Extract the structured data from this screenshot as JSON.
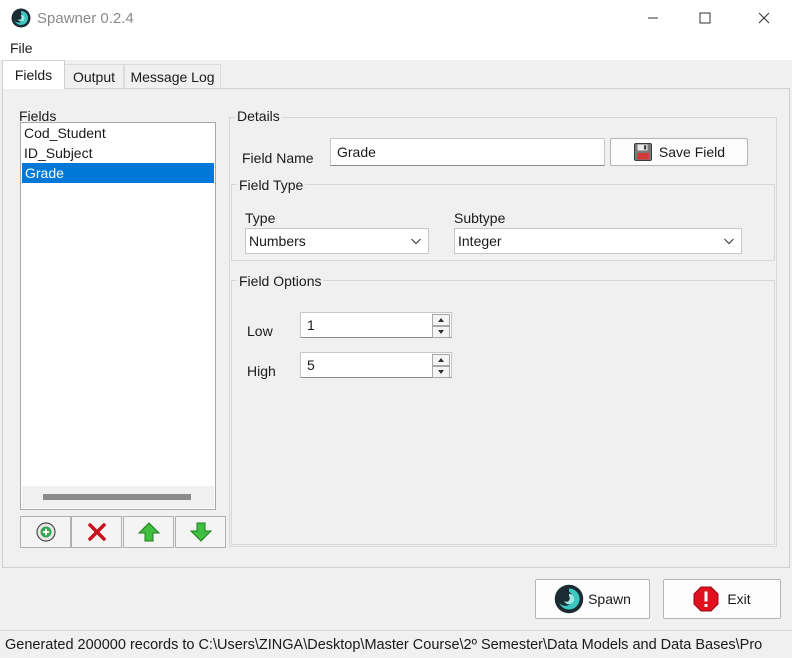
{
  "window": {
    "title": "Spawner 0.2.4",
    "icon": "spawner-swirl-icon"
  },
  "menu": {
    "file": "File"
  },
  "tabs": [
    {
      "label": "Fields",
      "active": true
    },
    {
      "label": "Output",
      "active": false
    },
    {
      "label": "Message Log",
      "active": false
    }
  ],
  "fields_panel": {
    "caption": "Fields",
    "items": [
      {
        "label": "Cod_Student",
        "selected": false
      },
      {
        "label": "ID_Subject",
        "selected": false
      },
      {
        "label": "Grade",
        "selected": true
      }
    ],
    "buttons": [
      {
        "action": "add",
        "icon": "add-circle-icon"
      },
      {
        "action": "delete",
        "icon": "red-x-icon"
      },
      {
        "action": "move-up",
        "icon": "green-up-arrow-icon"
      },
      {
        "action": "move-down",
        "icon": "green-down-arrow-icon"
      }
    ]
  },
  "details": {
    "group_label": "Details",
    "field_name_label": "Field Name",
    "field_name_value": "Grade",
    "save_button": "Save Field",
    "save_icon": "floppy-disk-icon"
  },
  "field_type": {
    "group_label": "Field Type",
    "type_label": "Type",
    "type_value": "Numbers",
    "subtype_label": "Subtype",
    "subtype_value": "Integer"
  },
  "field_options": {
    "group_label": "Field Options",
    "low_label": "Low",
    "low_value": "1",
    "high_label": "High",
    "high_value": "5"
  },
  "actions": {
    "spawn": "Spawn",
    "exit": "Exit"
  },
  "status": "Generated 200000 records to C:\\Users\\ZINGA\\Desktop\\Master Course\\2º Semester\\Data Models and Data Bases\\Pro",
  "colors": {
    "selection": "#0078d7",
    "accent_teal": "#1e9e9e",
    "exit_red": "#e0101e",
    "arrow_green": "#2fae2f"
  }
}
